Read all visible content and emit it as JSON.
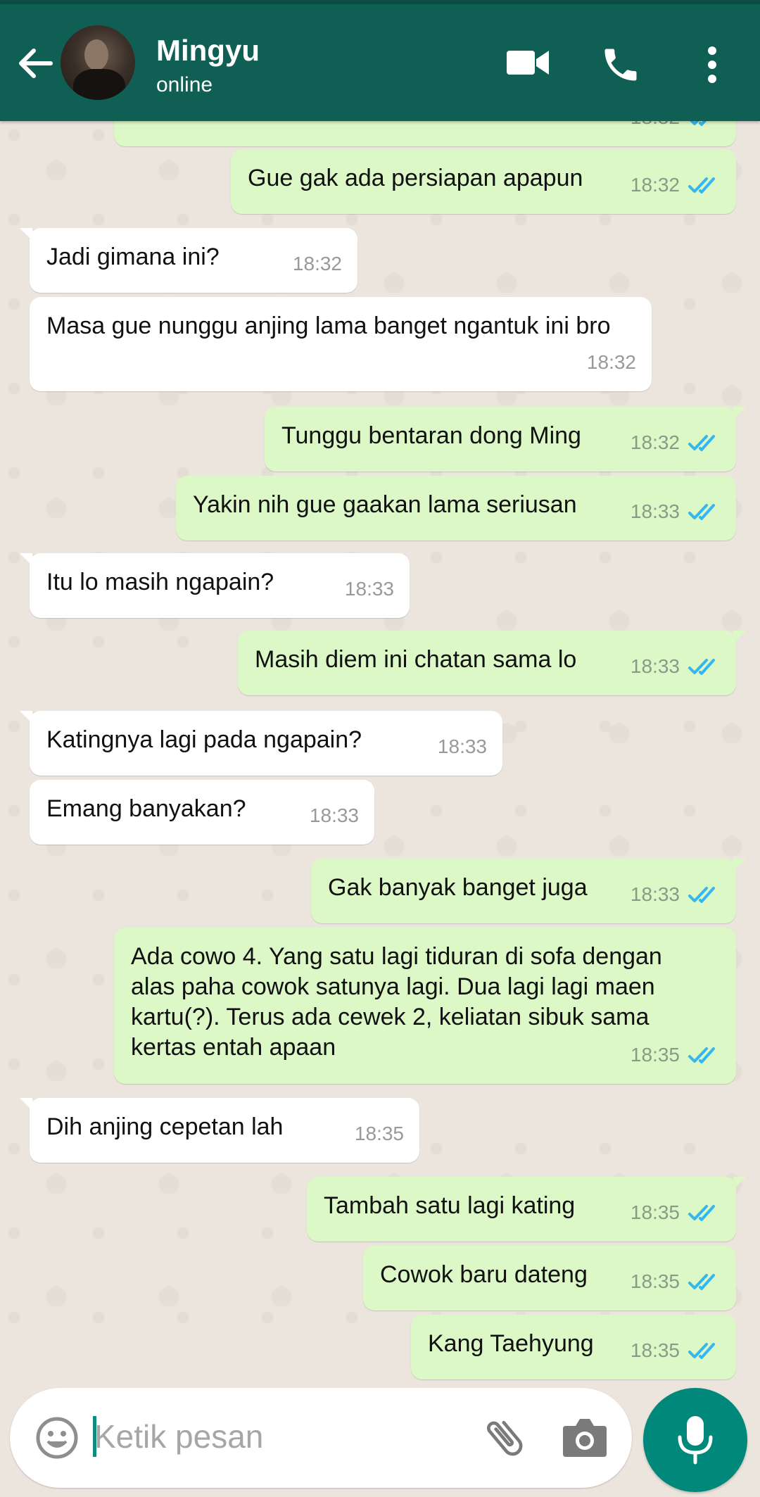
{
  "header": {
    "contact_name": "Mingyu",
    "contact_status": "online",
    "icons": [
      "back-arrow-icon",
      "video-call-icon",
      "voice-call-icon",
      "more-options-icon"
    ]
  },
  "colors": {
    "header": "#0f5f55",
    "outgoing_bubble": "#dcf8c6",
    "incoming_bubble": "#ffffff",
    "read_ticks": "#34b7f1",
    "mic_button": "#00897b"
  },
  "messages": [
    {
      "dir": "out",
      "text": "",
      "time": "18:32",
      "read": true
    },
    {
      "dir": "out",
      "text": "Gue gak ada persiapan apapun",
      "time": "18:32",
      "read": true
    },
    {
      "dir": "in",
      "text": "Jadi gimana ini?",
      "time": "18:32"
    },
    {
      "dir": "in",
      "text": "Masa gue nunggu anjing lama banget ngantuk ini bro",
      "time": "18:32"
    },
    {
      "dir": "out",
      "text": "Tunggu bentaran dong Ming",
      "time": "18:32",
      "read": true
    },
    {
      "dir": "out",
      "text": "Yakin nih gue gaakan lama seriusan",
      "time": "18:33",
      "read": true
    },
    {
      "dir": "in",
      "text": "Itu lo masih ngapain?",
      "time": "18:33"
    },
    {
      "dir": "out",
      "text": "Masih diem ini chatan sama lo",
      "time": "18:33",
      "read": true
    },
    {
      "dir": "in",
      "text": "Katingnya lagi pada ngapain?",
      "time": "18:33"
    },
    {
      "dir": "in",
      "text": "Emang banyakan?",
      "time": "18:33"
    },
    {
      "dir": "out",
      "text": "Gak banyak banget juga",
      "time": "18:33",
      "read": true
    },
    {
      "dir": "out",
      "text": "Ada cowo 4. Yang satu lagi tiduran di sofa dengan alas paha cowok satunya lagi. Dua lagi lagi maen kartu(?). Terus ada cewek 2, keliatan sibuk sama kertas entah apaan",
      "time": "18:35",
      "read": true
    },
    {
      "dir": "in",
      "text": "Dih anjing cepetan lah",
      "time": "18:35"
    },
    {
      "dir": "out",
      "text": "Tambah satu lagi kating",
      "time": "18:35",
      "read": true
    },
    {
      "dir": "out",
      "text": "Cowok baru dateng",
      "time": "18:35",
      "read": true
    },
    {
      "dir": "out",
      "text": "Kang Taehyung",
      "time": "18:35",
      "read": true
    }
  ],
  "composer": {
    "placeholder": "Ketik pesan",
    "icons": [
      "emoji-icon",
      "attach-icon",
      "camera-icon",
      "mic-icon"
    ]
  }
}
